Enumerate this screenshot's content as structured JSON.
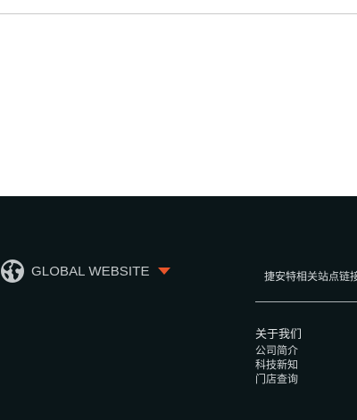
{
  "footer": {
    "global_website": {
      "label": "GLOBAL WEBSITE",
      "icon": "globe-icon",
      "caret_icon": "caret-down-icon",
      "caret_color": "#e8552a"
    },
    "related_links_text": "捷安特相关站点链接",
    "about": {
      "heading": "关于我们",
      "items": [
        "公司简介",
        "科技新知",
        "门店查询"
      ]
    },
    "background_color": "#0b1619"
  }
}
